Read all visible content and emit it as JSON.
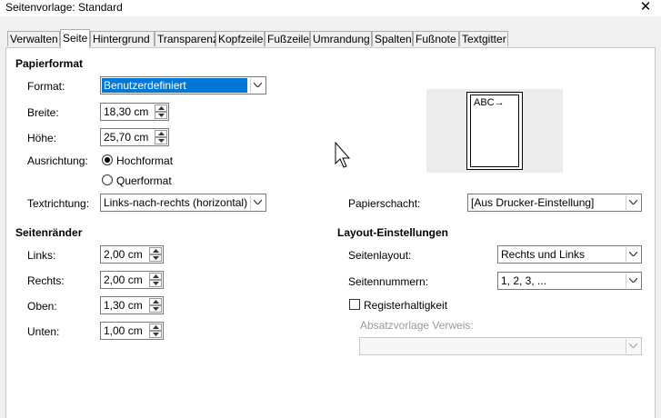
{
  "window": {
    "title": "Seitenvorlage: Standard",
    "close_symbol": "✕"
  },
  "tabs": [
    {
      "label": "Verwalten"
    },
    {
      "label": "Seite"
    },
    {
      "label": "Hintergrund"
    },
    {
      "label": "Transparenz"
    },
    {
      "label": "Kopfzeile"
    },
    {
      "label": "Fußzeile"
    },
    {
      "label": "Umrandung"
    },
    {
      "label": "Spalten"
    },
    {
      "label": "Fußnote"
    },
    {
      "label": "Textgitter"
    }
  ],
  "active_tab": "Seite",
  "papierformat": {
    "title": "Papierformat",
    "format": {
      "label": "Format:",
      "value": "Benutzerdefiniert"
    },
    "breite": {
      "label": "Breite:",
      "value": "18,30 cm"
    },
    "hoehe": {
      "label": "Höhe:",
      "value": "25,70 cm"
    },
    "ausrichtung": {
      "label": "Ausrichtung:",
      "options": [
        "Hochformat",
        "Querformat"
      ],
      "selected": "Hochformat"
    },
    "textrichtung": {
      "label": "Textrichtung:",
      "value": "Links-nach-rechts (horizontal)"
    }
  },
  "preview": {
    "text": "ABC→"
  },
  "papierschacht": {
    "label": "Papierschacht:",
    "value": "[Aus Drucker-Einstellung]"
  },
  "seitenraender": {
    "title": "Seitenränder",
    "links": {
      "label": "Links:",
      "value": "2,00 cm"
    },
    "rechts": {
      "label": "Rechts:",
      "value": "2,00 cm"
    },
    "oben": {
      "label": "Oben:",
      "value": "1,30 cm"
    },
    "unten": {
      "label": "Unten:",
      "value": "1,00 cm"
    }
  },
  "layout": {
    "title": "Layout-Einstellungen",
    "seitenlayout": {
      "label": "Seitenlayout:",
      "value": "Rechts und Links"
    },
    "seitennummern": {
      "label": "Seitennummern:",
      "value": "1, 2, 3, ..."
    },
    "registerhaltigkeit": {
      "label": "Registerhaltigkeit",
      "checked": false
    },
    "absatzvorlage": {
      "label": "Absatzvorlage Verweis:",
      "value": ""
    }
  }
}
